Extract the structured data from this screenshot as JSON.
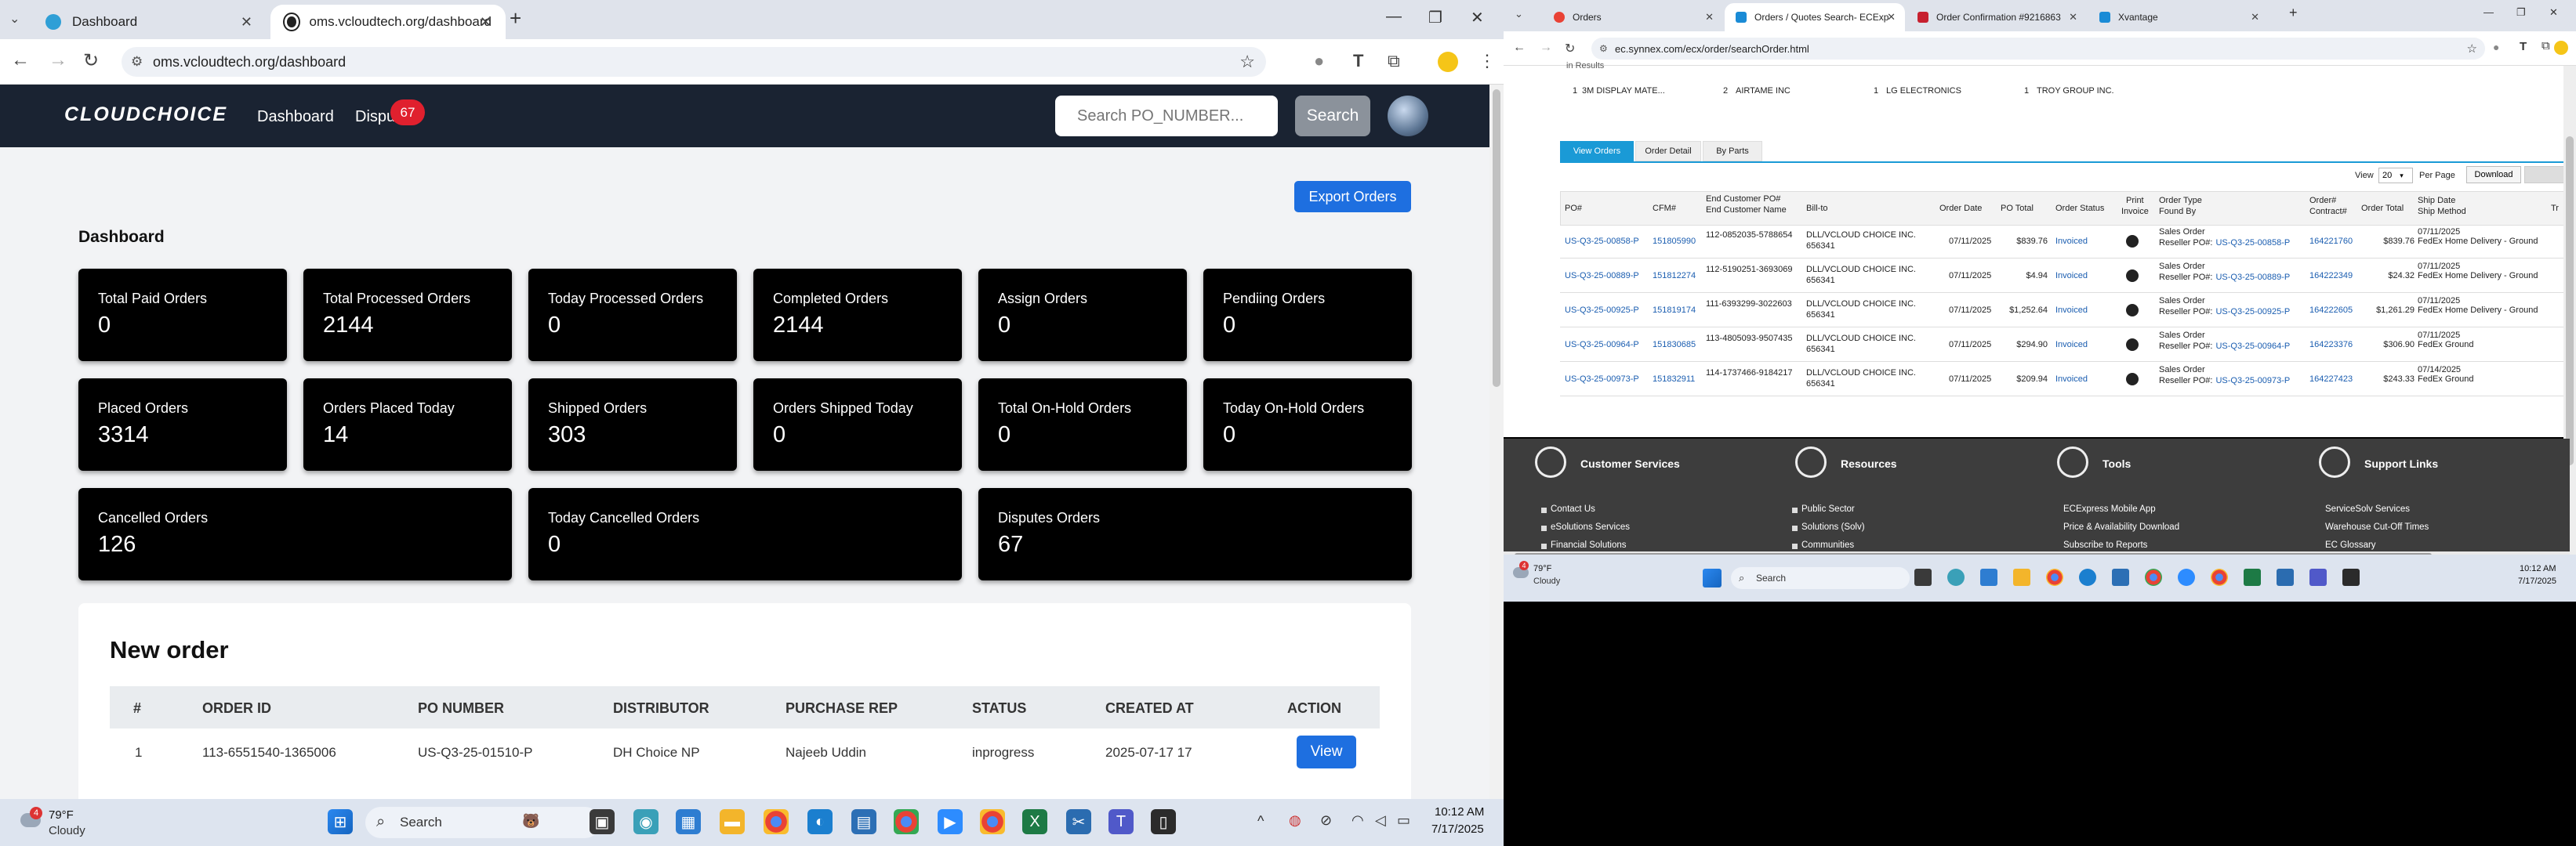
{
  "left": {
    "tabs": [
      {
        "title": "Dashboard",
        "active": false
      },
      {
        "title": "oms.vcloudtech.org/dashboard",
        "active": true
      }
    ],
    "url": "oms.vcloudtech.org/dashboard",
    "nav": {
      "logo": "CLOUDCHOICE",
      "dashboard": "Dashboard",
      "disputes": "Dispu",
      "disputes_badge": "67",
      "search_placeholder": "Search PO_NUMBER...",
      "search_button": "Search"
    },
    "export_button": "Export Orders",
    "dashboard_title": "Dashboard",
    "cards": [
      {
        "title": "Total Paid Orders",
        "value": "0"
      },
      {
        "title": "Total Processed Orders",
        "value": "2144"
      },
      {
        "title": "Today Processed Orders",
        "value": "0"
      },
      {
        "title": "Completed Orders",
        "value": "2144"
      },
      {
        "title": "Assign Orders",
        "value": "0"
      },
      {
        "title": "Pendiing Orders",
        "value": "0"
      },
      {
        "title": "Placed Orders",
        "value": "3314"
      },
      {
        "title": "Orders Placed Today",
        "value": "14"
      },
      {
        "title": "Shipped Orders",
        "value": "303"
      },
      {
        "title": "Orders Shipped Today",
        "value": "0"
      },
      {
        "title": "Total On-Hold Orders",
        "value": "0"
      },
      {
        "title": "Today On-Hold Orders",
        "value": "0"
      },
      {
        "title": "Cancelled Orders",
        "value": "126"
      },
      {
        "title": "Today Cancelled Orders",
        "value": "0"
      },
      {
        "title": "Disputes Orders",
        "value": "67"
      }
    ],
    "new_order": {
      "title": "New order",
      "headers": [
        "#",
        "ORDER ID",
        "PO NUMBER",
        "DISTRIBUTOR",
        "PURCHASE REP",
        "STATUS",
        "CREATED AT",
        "ACTION"
      ],
      "row": {
        "num": "1",
        "order_id": "113-6551540-1365006",
        "po": "US-Q3-25-01510-P",
        "distributor": "DH Choice NP",
        "rep": "Najeeb Uddin",
        "status": "inprogress",
        "created": "2025-07-17 17",
        "action": "View"
      }
    },
    "taskbar": {
      "temp": "79°F",
      "weather": "Cloudy",
      "weather_badge": "4",
      "search": "Search",
      "time": "10:12 AM",
      "date": "7/17/2025"
    }
  },
  "right": {
    "tabs": [
      {
        "title": "Orders"
      },
      {
        "title": "Orders / Quotes Search- ECExp"
      },
      {
        "title": "Order Confirmation #9216863"
      },
      {
        "title": "Xvantage"
      }
    ],
    "url": "ec.synnex.com/ecx/order/searchOrder.html",
    "results_label": "in Results",
    "filters": [
      {
        "count": "1",
        "name": "3M DISPLAY MATE..."
      },
      {
        "count": "2",
        "name": "AIRTAME INC"
      },
      {
        "count": "1",
        "name": "LG ELECTRONICS"
      },
      {
        "count": "1",
        "name": "TROY GROUP INC."
      }
    ],
    "subtabs": [
      "View Orders",
      "Order Detail",
      "By Parts"
    ],
    "view_label": "View",
    "per_page_value": "20",
    "per_page_label": "Per Page",
    "download": "Download",
    "headers": {
      "po": "PO#",
      "cfm": "CFM#",
      "endcust": "End Customer PO#",
      "endcust2": "End Customer Name",
      "billto": "Bill-to",
      "orderdate": "Order Date",
      "pototal": "PO Total",
      "status": "Order Status",
      "print": "Print",
      "print2": "Invoice",
      "ordertype": "Order Type",
      "foundby": "Found By",
      "ordernum": "Order#",
      "contract": "Contract#",
      "ordertotal": "Order Total",
      "shipdate": "Ship Date",
      "shipmethod": "Ship Method",
      "tr": "Tr"
    },
    "rows": [
      {
        "po": "US-Q3-25-00858-P",
        "cfm": "151805990",
        "endpo": "112-0852035-5788654",
        "billto": "DLL/VCLOUD CHOICE INC.",
        "acct": "656341",
        "date": "07/11/2025",
        "total": "$839.76",
        "status": "Invoiced",
        "type": "Sales Order",
        "found": "US-Q3-25-00858-P",
        "order": "164221760",
        "ototal": "$839.76",
        "ship": "07/11/2025",
        "method": "FedEx Home Delivery - Ground"
      },
      {
        "po": "US-Q3-25-00889-P",
        "cfm": "151812274",
        "endpo": "112-5190251-3693069",
        "billto": "DLL/VCLOUD CHOICE INC.",
        "acct": "656341",
        "date": "07/11/2025",
        "total": "$4.94",
        "status": "Invoiced",
        "type": "Sales Order",
        "found": "US-Q3-25-00889-P",
        "order": "164222349",
        "ototal": "$24.32",
        "ship": "07/11/2025",
        "method": "FedEx Home Delivery - Ground"
      },
      {
        "po": "US-Q3-25-00925-P",
        "cfm": "151819174",
        "endpo": "111-6393299-3022603",
        "billto": "DLL/VCLOUD CHOICE INC.",
        "acct": "656341",
        "date": "07/11/2025",
        "total": "$1,252.64",
        "status": "Invoiced",
        "type": "Sales Order",
        "found": "US-Q3-25-00925-P",
        "order": "164222605",
        "ototal": "$1,261.29",
        "ship": "07/11/2025",
        "method": "FedEx Home Delivery - Ground"
      },
      {
        "po": "US-Q3-25-00964-P",
        "cfm": "151830685",
        "endpo": "113-4805093-9507435",
        "billto": "DLL/VCLOUD CHOICE INC.",
        "acct": "656341",
        "date": "07/11/2025",
        "total": "$294.90",
        "status": "Invoiced",
        "type": "Sales Order",
        "found": "US-Q3-25-00964-P",
        "order": "164223376",
        "ototal": "$306.90",
        "ship": "07/11/2025",
        "method": "FedEx Ground"
      },
      {
        "po": "US-Q3-25-00973-P",
        "cfm": "151832911",
        "endpo": "114-1737466-9184217",
        "billto": "DLL/VCLOUD CHOICE INC.",
        "acct": "656341",
        "date": "07/11/2025",
        "total": "$209.94",
        "status": "Invoiced",
        "type": "Sales Order",
        "found": "US-Q3-25-00973-P",
        "order": "164227423",
        "ototal": "$243.33",
        "ship": "07/14/2025",
        "method": "FedEx Ground"
      }
    ],
    "reseller_prefix": "Reseller PO#:",
    "footer": [
      {
        "title": "Customer Services",
        "items": [
          "Contact Us",
          "eSolutions Services",
          "Financial Solutions"
        ]
      },
      {
        "title": "Resources",
        "items": [
          "Public Sector",
          "Solutions (Solv)",
          "Communities"
        ]
      },
      {
        "title": "Tools",
        "items": [
          "ECExpress Mobile App",
          "Price & Availability Download",
          "Subscribe to Reports"
        ]
      },
      {
        "title": "Support Links",
        "items": [
          "ServiceSolv Services",
          "Warehouse Cut-Off Times",
          "EC Glossary"
        ]
      }
    ],
    "taskbar": {
      "temp": "79°F",
      "weather": "Cloudy",
      "weather_badge": "4",
      "search": "Search",
      "time": "10:12 AM",
      "date": "7/17/2025"
    }
  }
}
